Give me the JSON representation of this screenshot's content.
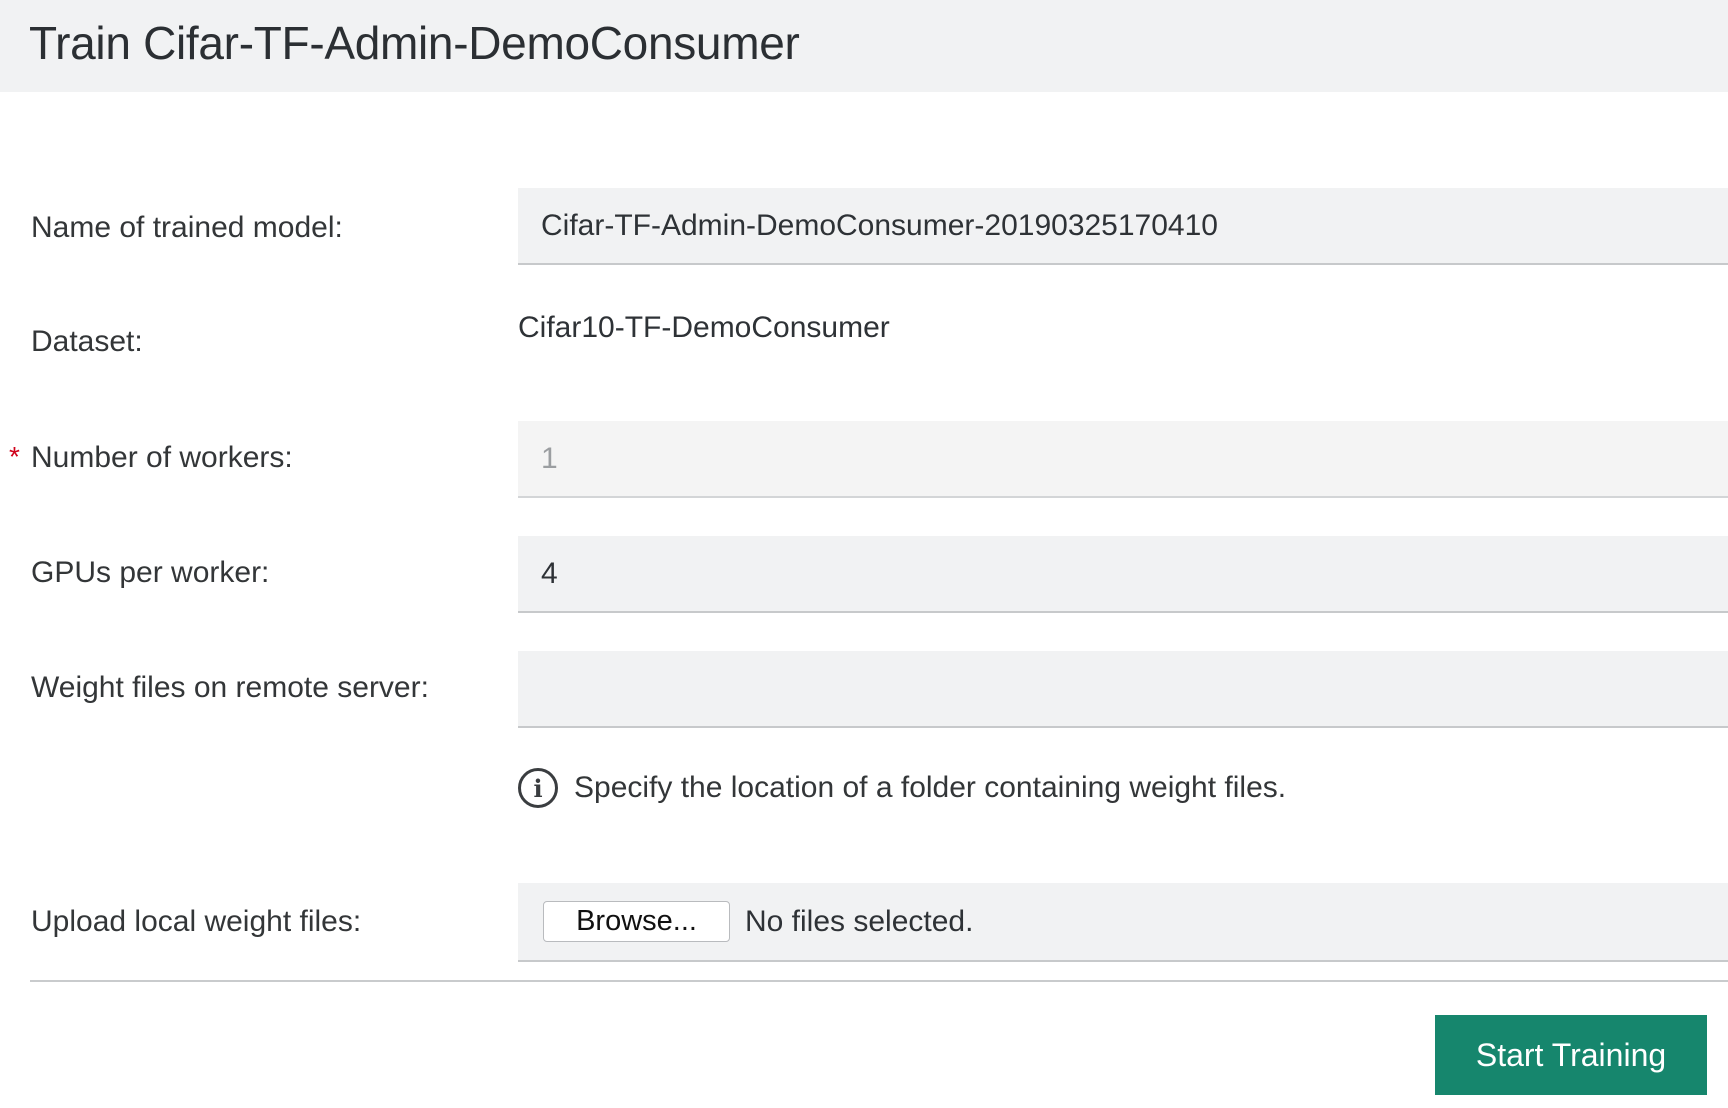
{
  "page": {
    "title": "Train Cifar-TF-Admin-DemoConsumer"
  },
  "form": {
    "model_name": {
      "label": "Name of trained model:",
      "value": "Cifar-TF-Admin-DemoConsumer-20190325170410"
    },
    "dataset": {
      "label": "Dataset:",
      "value": "Cifar10-TF-DemoConsumer"
    },
    "workers": {
      "required_marker": "*",
      "label": "Number of workers:",
      "value": "1",
      "disabled": true
    },
    "gpus": {
      "label": "GPUs per worker:",
      "value": "4"
    },
    "remote_weights": {
      "label": "Weight files on remote server:",
      "value": "",
      "hint_icon": "info-icon",
      "hint": "Specify the location of a folder containing weight files."
    },
    "local_weights": {
      "label": "Upload local weight files:",
      "browse_label": "Browse...",
      "status": "No files selected."
    }
  },
  "actions": {
    "start_label": "Start Training"
  },
  "colors": {
    "header_bg": "#f1f2f3",
    "field_bg": "#f1f2f3",
    "primary": "#16866d",
    "required": "#d0021b"
  }
}
